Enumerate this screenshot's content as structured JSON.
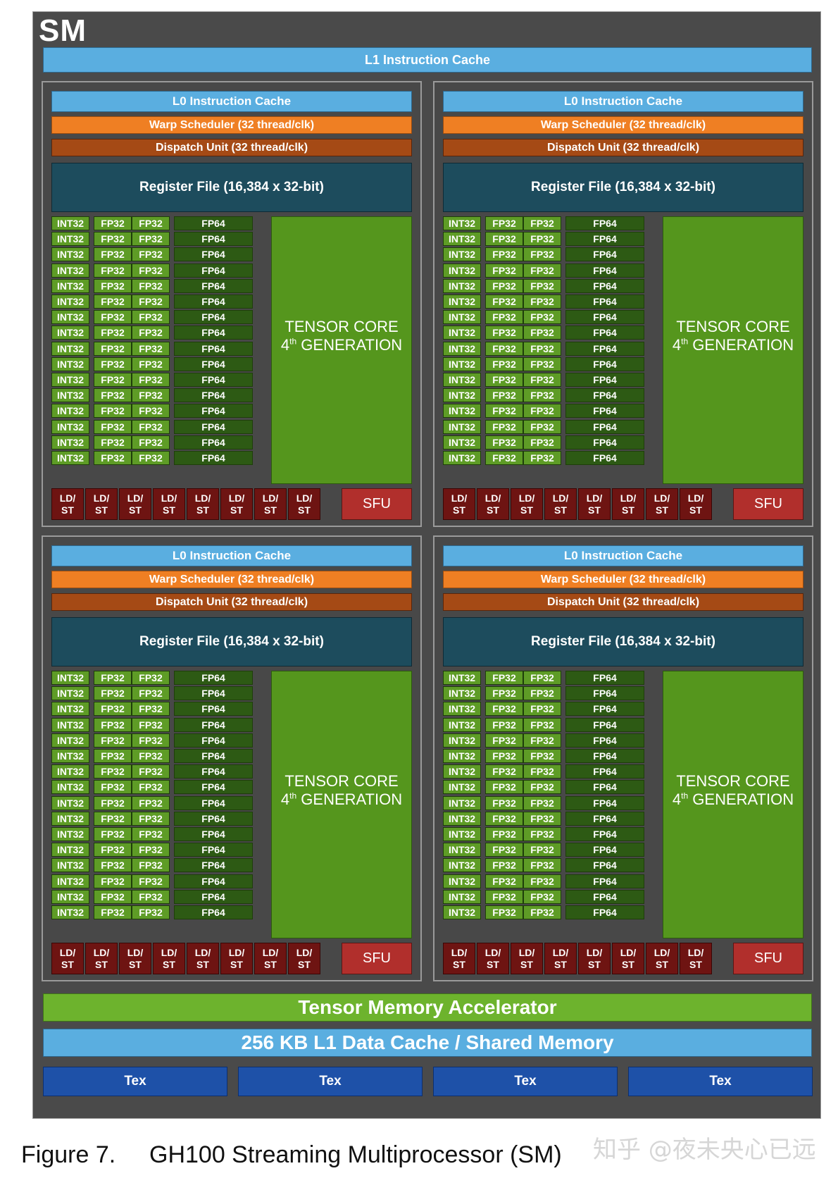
{
  "sm": {
    "title": "SM",
    "l1_instruction_cache": "L1 Instruction Cache",
    "tensor_memory_accelerator": "Tensor Memory Accelerator",
    "l1_data_cache": "256 KB L1 Data Cache / Shared Memory",
    "tex_units": [
      "Tex",
      "Tex",
      "Tex",
      "Tex"
    ]
  },
  "partition": {
    "l0_cache": "L0 Instruction Cache",
    "warp_scheduler": "Warp Scheduler (32 thread/clk)",
    "dispatch_unit": "Dispatch Unit (32 thread/clk)",
    "register_file": "Register File (16,384 x 32-bit)",
    "int32_label": "INT32",
    "fp32_label": "FP32",
    "fp64_label": "FP64",
    "rows_per_partition": 16,
    "ldst_units": 8,
    "ldst_line1": "LD/",
    "ldst_line2": "ST",
    "sfu_label": "SFU",
    "tensor_line1": "TENSOR CORE",
    "tensor_gen_num": "4",
    "tensor_gen_sup": "th",
    "tensor_gen_text": "GENERATION"
  },
  "partitions_count": 4,
  "caption": {
    "figure": "Figure 7.",
    "title": "GH100 Streaming Multiprocessor (SM)"
  },
  "watermark": "知乎 @夜未央心已远",
  "colors": {
    "cache_blue": "#5aaee0",
    "warp_orange": "#ef7f23",
    "dispatch_brown": "#a54a15",
    "register_teal": "#1d4c5d",
    "core_green": "#5e9c26",
    "fp64_dark_green": "#2d5a14",
    "tensor_green": "#55961d",
    "ldst_dark_red": "#6e1412",
    "sfu_red": "#b12f2c",
    "tex_blue": "#1e51a8",
    "tma_green": "#6db32d",
    "sm_gray": "#4a4a4a"
  }
}
